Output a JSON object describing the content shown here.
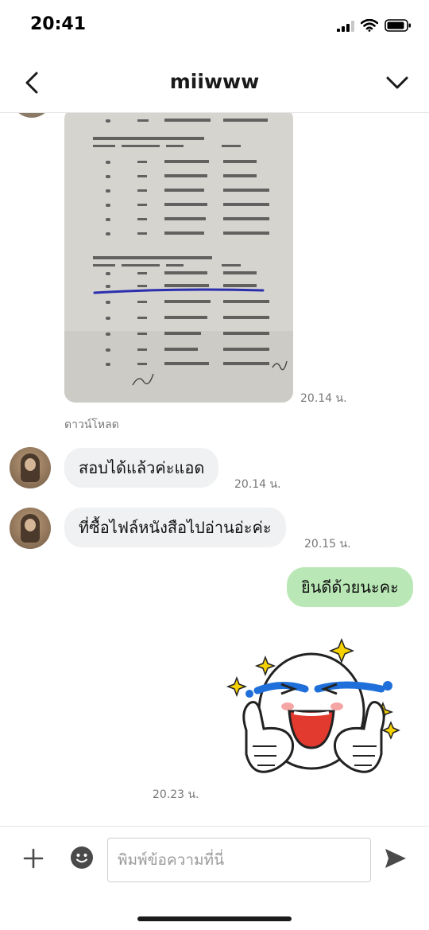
{
  "status_bar": {
    "time": "20:41",
    "icons": [
      "signal-icon",
      "wifi-icon",
      "battery-icon"
    ]
  },
  "header": {
    "title": "miiwww",
    "back_icon": "chevron-left-icon",
    "menu_icon": "chevron-down-icon"
  },
  "messages": [
    {
      "type": "image",
      "sender": "them",
      "content": "scanned-document-photo",
      "time": "20.14 น.",
      "action": "ดาวน์โหลด"
    },
    {
      "type": "text",
      "sender": "them",
      "text": "สอบได้แล้วค่ะแอด",
      "time": "20.14 น."
    },
    {
      "type": "text",
      "sender": "them",
      "text": "ที่ซื้อไฟล์หนังสือไปอ่านอ่ะค่ะ",
      "time": "20.15 น."
    },
    {
      "type": "text",
      "sender": "me",
      "text": "ยินดีด้วยนะคะ"
    },
    {
      "type": "sticker",
      "sender": "me",
      "content": "crying-laughing-thumbs-up-sticker",
      "time": "20.23 น."
    }
  ],
  "input_bar": {
    "placeholder": "พิมพ์ข้อความที่นี่",
    "value": "",
    "icons": [
      "plus-icon",
      "emoji-icon",
      "send-icon"
    ]
  },
  "colors": {
    "outgoing_bubble": "#b9e8b6",
    "incoming_bubble": "#f0f1f3",
    "timestamp": "#777777"
  }
}
